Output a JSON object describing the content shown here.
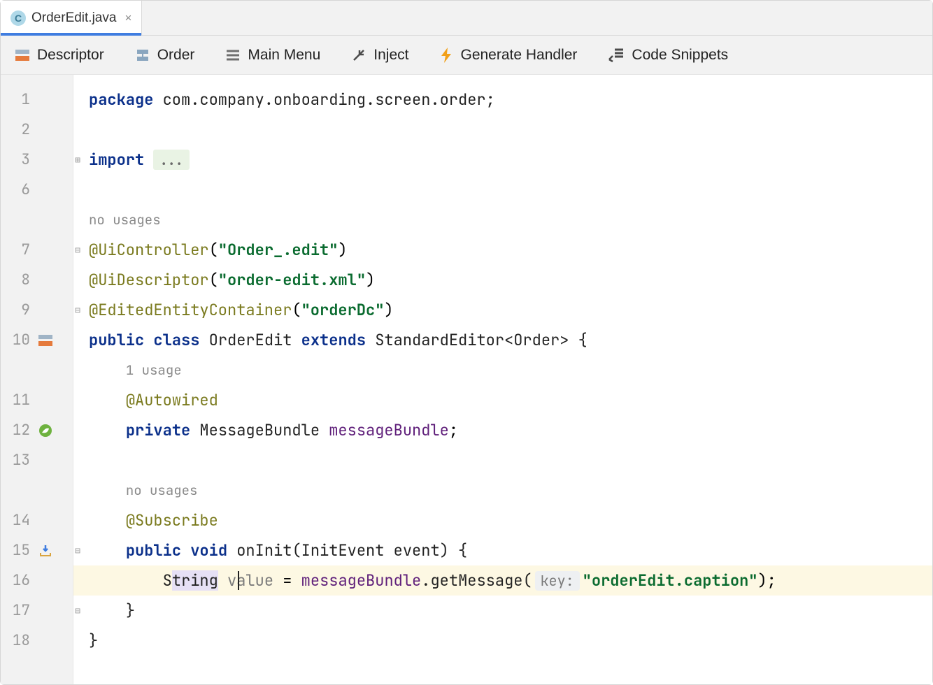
{
  "tab": {
    "filename": "OrderEdit.java",
    "icon_letter": "C"
  },
  "toolbar": {
    "descriptor": "Descriptor",
    "order": "Order",
    "main_menu": "Main Menu",
    "inject": "Inject",
    "generate_handler": "Generate Handler",
    "code_snippets": "Code Snippets"
  },
  "gutter_lines": [
    "1",
    "2",
    "3",
    "6",
    "",
    "7",
    "8",
    "9",
    "10",
    "",
    "11",
    "12",
    "13",
    "",
    "14",
    "15",
    "16",
    "17",
    "18"
  ],
  "hints": {
    "no_usages": "no usages",
    "one_usage": "1 usage",
    "key": "key:"
  },
  "code": {
    "pkg_kw": "package",
    "pkg": "com.company.onboarding.screen.order;",
    "import_kw": "import",
    "dots": "...",
    "ann_uicontroller": "@UiController",
    "str_uicontroller": "\"Order_.edit\"",
    "ann_uidescriptor": "@UiDescriptor",
    "str_uidescriptor": "\"order-edit.xml\"",
    "ann_editedentity": "@EditedEntityContainer",
    "str_editedentity": "\"orderDc\"",
    "public": "public",
    "class": "class",
    "classname": "OrderEdit",
    "extends": "extends",
    "supertype": "StandardEditor<Order> {",
    "autowired": "@Autowired",
    "private": "private",
    "msgbundle_type": "MessageBundle",
    "msgbundle_name": "messageBundle",
    "subscribe": "@Subscribe",
    "void": "void",
    "oninit": "onInit",
    "initevent": "(InitEvent event) {",
    "stringtype": "String",
    "stringtype_pre": "S",
    "stringtype_mid": "tring",
    "valuevar": "value",
    "eq": " = ",
    "msgbundle_call_obj": "messageBundle",
    "msgbundle_call_method": ".getMessage(",
    "caption_str": "\"orderEdit.caption\"",
    "call_close": ");",
    "brace_close": "}",
    "brace_close2": "}"
  }
}
